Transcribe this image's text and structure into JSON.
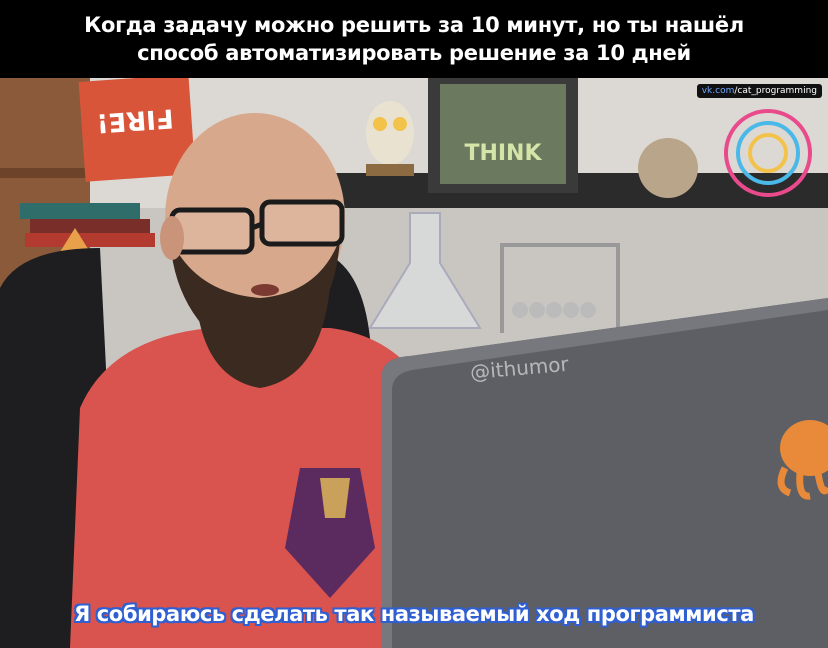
{
  "top_caption": "Когда задачу можно решить за 10 минут, но ты нашёл\nспособ автоматизировать решение за 10 дней",
  "source_tag": {
    "brand": "vk.com",
    "path": "/cat_programming"
  },
  "watermark": "@ithumor",
  "poster_text": "FIRE!",
  "frame_text": "THINK",
  "subtitle": "Я собираюсь сделать так называемый ход программиста",
  "colors": {
    "caption_bg": "#000000",
    "subtitle_outline": "#2f5fd0",
    "shirt": "#d9534f",
    "laptop": "#5d5f64"
  }
}
